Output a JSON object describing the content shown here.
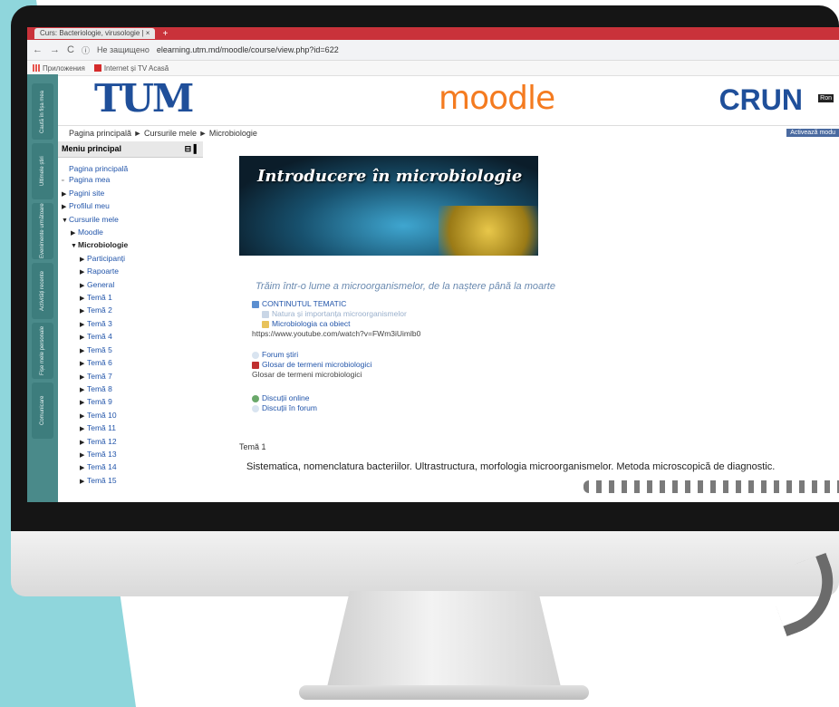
{
  "browser": {
    "tab_title": "Curs: Bacteriologie, virusologie | ",
    "tab_close": "×",
    "new_tab": "+",
    "security_label": "Не защищено",
    "url": "elearning.utm.md/moodle/course/view.php?id=622",
    "bookmarks": [
      "Приложения",
      "Internet și TV Acasă"
    ]
  },
  "header": {
    "logo_left": "TUM",
    "logo_center": "moodle",
    "logo_right": "CRUN",
    "lang": "Ron"
  },
  "breadcrumb": "Pagina principală ► Cursurile mele ► Microbiologie",
  "activate_button": "Activează modu",
  "dock": [
    "Caută în fișa mea",
    "Ultimele știri",
    "Evenimente următoare",
    "Activități recente",
    "Fișe mele personale",
    "Comunicare"
  ],
  "sidebar": {
    "title": "Meniu principal",
    "controls": "⊟ ▌",
    "items": [
      {
        "label": "Pagina principală",
        "arrow": ""
      },
      {
        "label": "Pagina mea",
        "arrow": "▫"
      },
      {
        "label": "Pagini site",
        "arrow": "▶"
      },
      {
        "label": "Profilul meu",
        "arrow": "▶"
      },
      {
        "label": "Cursurile mele",
        "arrow": "▼"
      },
      {
        "label": "Moodle",
        "arrow": "▶"
      },
      {
        "label": "Microbiologie",
        "arrow": "▼"
      },
      {
        "label": "Participanți",
        "arrow": "▶"
      },
      {
        "label": "Rapoarte",
        "arrow": "▶"
      },
      {
        "label": "General",
        "arrow": "▶"
      },
      {
        "label": "Temă 1",
        "arrow": "▶"
      },
      {
        "label": "Temă 2",
        "arrow": "▶"
      },
      {
        "label": "Temă 3",
        "arrow": "▶"
      },
      {
        "label": "Temă 4",
        "arrow": "▶"
      },
      {
        "label": "Temă 5",
        "arrow": "▶"
      },
      {
        "label": "Temă 6",
        "arrow": "▶"
      },
      {
        "label": "Temă 7",
        "arrow": "▶"
      },
      {
        "label": "Temă 8",
        "arrow": "▶"
      },
      {
        "label": "Temă 9",
        "arrow": "▶"
      },
      {
        "label": "Temă 10",
        "arrow": "▶"
      },
      {
        "label": "Temă 11",
        "arrow": "▶"
      },
      {
        "label": "Temă 12",
        "arrow": "▶"
      },
      {
        "label": "Temă 13",
        "arrow": "▶"
      },
      {
        "label": "Temă 14",
        "arrow": "▶"
      },
      {
        "label": "Temă 15",
        "arrow": "▶"
      }
    ]
  },
  "content": {
    "banner_title": "Introducere în microbiologie",
    "motto": "Trăim într-o lume a microorganismelor, de la naștere până la moarte",
    "tematic": {
      "heading": "CONTINUTUL TEMATIC",
      "item1": "Natura și importanța microorganismelor",
      "item2": "Microbiologia ca obiect",
      "item3": "https://www.youtube.com/watch?v=FWm3iUimlb0"
    },
    "forum": {
      "item1": "Forum știri",
      "item2": "Glosar de termeni microbiologici",
      "item3": "Glosar de termeni microbiologici"
    },
    "discutii": {
      "item1": "Discuții online",
      "item2": "Discuții în forum"
    },
    "tema_title": "Temă 1",
    "tema_desc": "Sistematica, nomenclatura bacteriilor. Ultrastructura, morfologia microorganismelor.  Metoda microscopică de diagnostic."
  },
  "colors": {
    "teal_background": "#8fd6dc",
    "moodle_orange": "#f47b20",
    "utm_blue": "#1f4f9a",
    "link_blue": "#2255aa",
    "browser_tab_red": "#c9323a"
  }
}
